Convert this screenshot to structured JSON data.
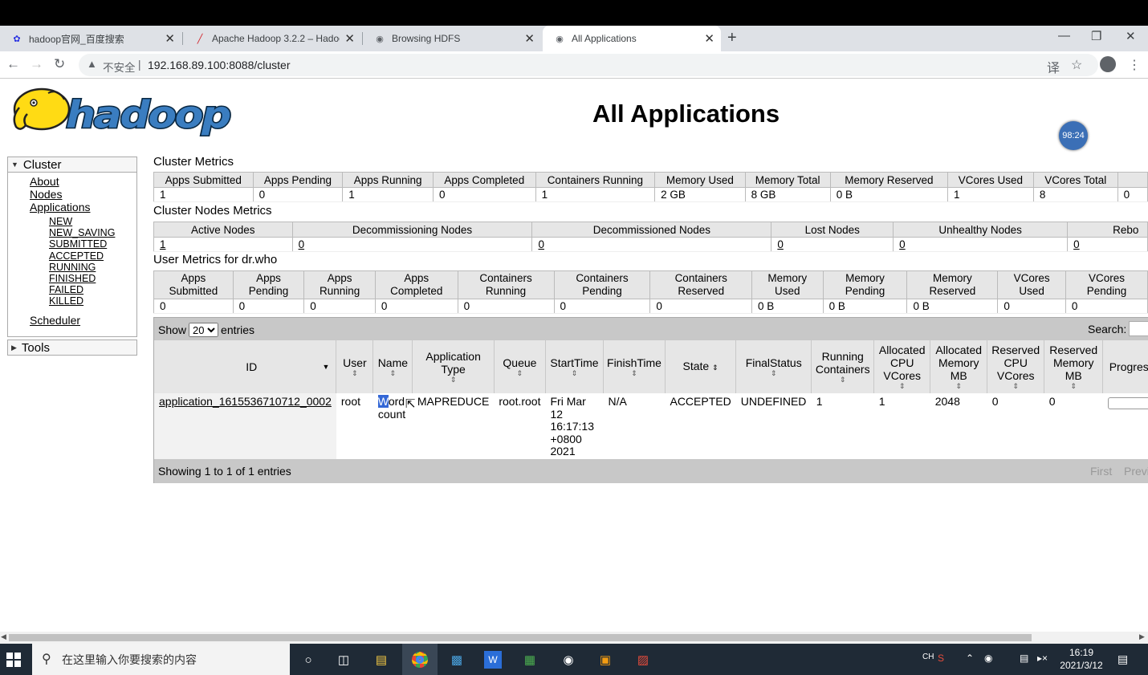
{
  "browser": {
    "tabs": [
      {
        "title": "hadoop官网_百度搜索",
        "icon": "baidu-paw-icon"
      },
      {
        "title": "Apache Hadoop 3.2.2 – Hadoo",
        "icon": "feather-icon"
      },
      {
        "title": "Browsing HDFS",
        "icon": "globe-icon"
      },
      {
        "title": "All Applications",
        "icon": "globe-icon"
      }
    ],
    "insecure_label": "不安全",
    "separator": "|",
    "url": "192.168.89.100:8088/cluster"
  },
  "page": {
    "title": "All Applications",
    "timer": "98:24"
  },
  "sidebar": {
    "cluster_label": "Cluster",
    "links": [
      "About",
      "Nodes",
      "Applications"
    ],
    "app_states": [
      "NEW",
      "NEW_SAVING",
      "SUBMITTED",
      "ACCEPTED",
      "RUNNING",
      "FINISHED",
      "FAILED",
      "KILLED"
    ],
    "scheduler": "Scheduler",
    "tools_label": "Tools"
  },
  "cluster_metrics": {
    "title": "Cluster Metrics",
    "headers": [
      "Apps Submitted",
      "Apps Pending",
      "Apps Running",
      "Apps Completed",
      "Containers Running",
      "Memory Used",
      "Memory Total",
      "Memory Reserved",
      "VCores Used",
      "VCores Total",
      ""
    ],
    "values": [
      "1",
      "0",
      "1",
      "0",
      "1",
      "2 GB",
      "8 GB",
      "0 B",
      "1",
      "8",
      "0"
    ]
  },
  "node_metrics": {
    "title": "Cluster Nodes Metrics",
    "headers": [
      "Active Nodes",
      "Decommissioning Nodes",
      "Decommissioned Nodes",
      "Lost Nodes",
      "Unhealthy Nodes",
      "Rebo"
    ],
    "values": [
      "1",
      "0",
      "0",
      "0",
      "0",
      "0"
    ]
  },
  "user_metrics": {
    "title": "User Metrics for dr.who",
    "headers": [
      [
        "Apps",
        "Submitted"
      ],
      [
        "Apps",
        "Pending"
      ],
      [
        "Apps",
        "Running"
      ],
      [
        "Apps",
        "Completed"
      ],
      [
        "Containers",
        "Running"
      ],
      [
        "Containers",
        "Pending"
      ],
      [
        "Containers",
        "Reserved"
      ],
      [
        "Memory",
        "Used"
      ],
      [
        "Memory",
        "Pending"
      ],
      [
        "Memory",
        "Reserved"
      ],
      [
        "VCores",
        "Used"
      ],
      [
        "VCores",
        "Pending"
      ]
    ],
    "values": [
      "0",
      "0",
      "0",
      "0",
      "0",
      "0",
      "0",
      "0 B",
      "0 B",
      "0 B",
      "0",
      "0"
    ]
  },
  "apps_table": {
    "show_label": "Show",
    "page_size": "20",
    "entries_label": "entries",
    "search_label": "Search:",
    "columns": [
      "ID",
      "User",
      "Name",
      "Application Type",
      "Queue",
      "StartTime",
      "FinishTime",
      "State",
      "FinalStatus",
      "Running Containers",
      "Allocated CPU VCores",
      "Allocated Memory MB",
      "Reserved CPU VCores",
      "Reserved Memory MB",
      "Progress"
    ],
    "rows": [
      {
        "id": "application_1615536710712_0002",
        "user": "root",
        "name_sel": "W",
        "name_rest": "ord",
        "name_line2": "count",
        "type": "MAPREDUCE",
        "queue": "root.root",
        "start_lines": [
          "Fri Mar",
          "12",
          "16:17:13",
          "+0800",
          "2021"
        ],
        "finish": "N/A",
        "state": "ACCEPTED",
        "final_status": "UNDEFINED",
        "running_containers": "1",
        "alloc_vcores": "1",
        "alloc_mem": "2048",
        "res_vcores": "0",
        "res_mem": "0",
        "progress": 0
      }
    ],
    "info": "Showing 1 to 1 of 1 entries",
    "first": "First",
    "previous": "Previ"
  },
  "taskbar": {
    "search_placeholder": "在这里输入你要搜索的内容",
    "ime": "CH",
    "time": "16:19",
    "date": "2021/3/12"
  }
}
